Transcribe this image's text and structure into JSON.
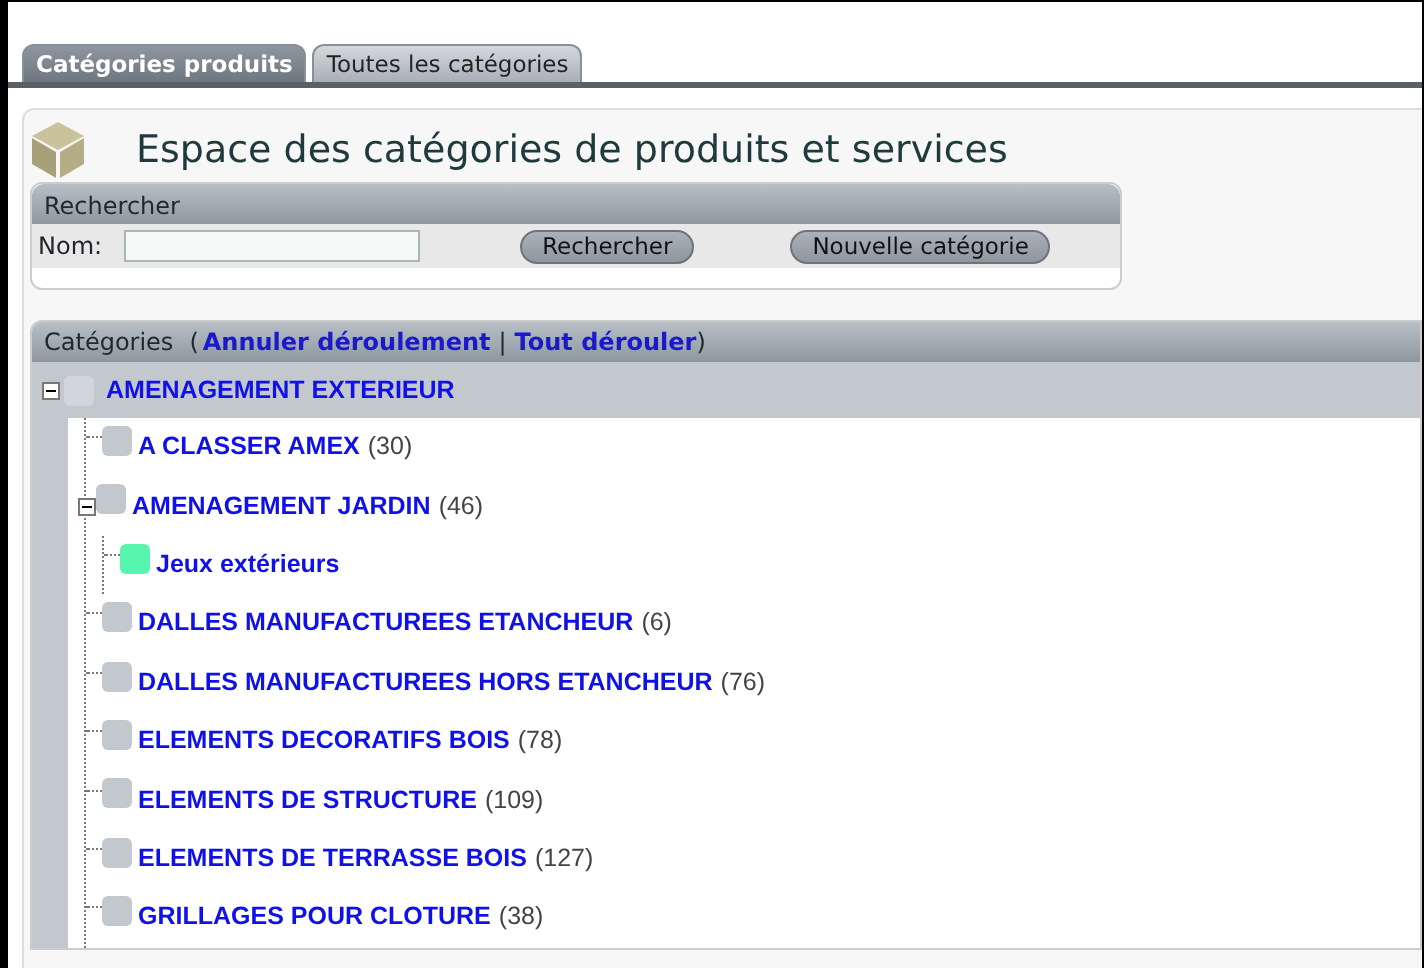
{
  "tabs": [
    {
      "label": "Catégories produits",
      "selected": true
    },
    {
      "label": "Toutes les catégories",
      "selected": false
    }
  ],
  "page_title": "Espace des catégories de produits et services",
  "search": {
    "title": "Rechercher",
    "field_label": "Nom:",
    "buttons": [
      "Rechercher",
      "Nouvelle catégorie"
    ]
  },
  "categories": {
    "title": "Catégories",
    "open_paren": "(",
    "links": [
      "Annuler déroulement",
      "Tout dérouler"
    ],
    "separator": "|",
    "close_paren": ")",
    "tree": [
      {
        "name": "AMENAGEMENT EXTERIEUR",
        "color": "#d2d6db",
        "expanded": true,
        "children": [
          {
            "name": "A CLASSER AMEX",
            "count": "(30)",
            "color": "#c3c8ce"
          },
          {
            "name": "AMENAGEMENT JARDIN",
            "count": "(46)",
            "color": "#c3c8ce",
            "expanded": true,
            "children": [
              {
                "name": "Jeux extérieurs",
                "color": "#55f5b0"
              }
            ]
          },
          {
            "name": "DALLES MANUFACTUREES ETANCHEUR",
            "count": "(6)",
            "color": "#c3c8ce"
          },
          {
            "name": "DALLES MANUFACTUREES HORS ETANCHEUR",
            "count": "(76)",
            "color": "#c3c8ce"
          },
          {
            "name": "ELEMENTS DECORATIFS BOIS",
            "count": "(78)",
            "color": "#c3c8ce"
          },
          {
            "name": "ELEMENTS DE STRUCTURE",
            "count": "(109)",
            "color": "#c3c8ce"
          },
          {
            "name": "ELEMENTS DE TERRASSE BOIS",
            "count": "(127)",
            "color": "#c3c8ce"
          },
          {
            "name": "GRILLAGES POUR CLOTURE",
            "count": "(38)",
            "color": "#c3c8ce"
          }
        ]
      }
    ]
  }
}
